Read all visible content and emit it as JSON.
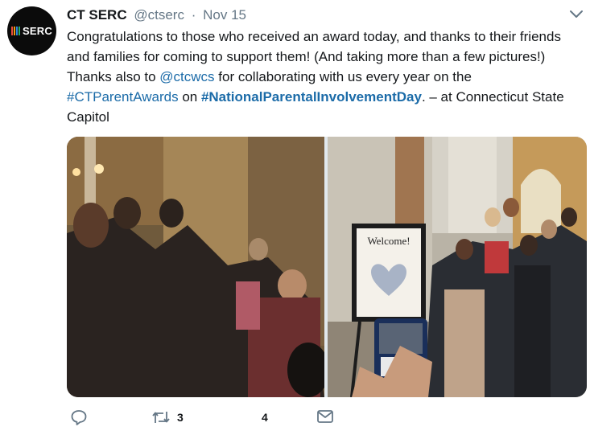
{
  "avatar": {
    "logo_text": "SERC",
    "bar_colors": [
      "#e84b3c",
      "#f39c12",
      "#2e86de",
      "#27ae60"
    ]
  },
  "tweet": {
    "name": "CT SERC",
    "handle": "@ctserc",
    "separator": "·",
    "date": "Nov 15",
    "text_1": "Congratulations to those who received an award today, and thanks to their friends and families for coming to support them! (And taking more than a few pictures!) Thanks also to ",
    "mention": "@ctcwcs",
    "text_2": " for collaborating with us every year on the ",
    "hashtag_1": "#CTParentAwards",
    "text_3": " on ",
    "hashtag_2": "#NationalParentalInvolvementDay",
    "text_4": ".  – at Connecticut State Capitol"
  },
  "photos": {
    "right_sign_title": "Welcome!"
  },
  "actions": {
    "reply_count": "",
    "retweet_count": "3",
    "like_count": "4"
  },
  "colors": {
    "link": "#1b6ba8",
    "muted": "#657786",
    "text": "#14171a"
  },
  "icons": [
    "caret-down-icon",
    "reply-icon",
    "retweet-icon",
    "like-icon",
    "direct-message-icon"
  ]
}
